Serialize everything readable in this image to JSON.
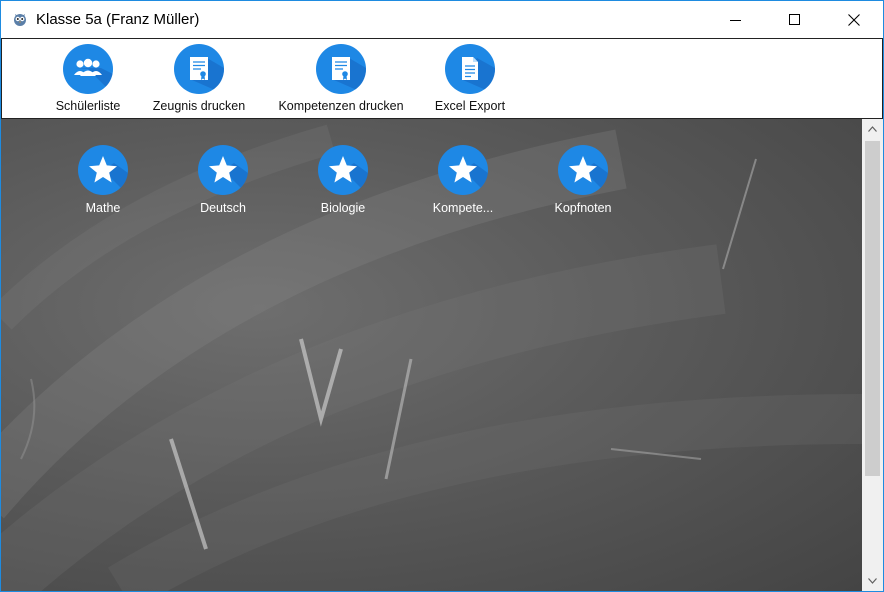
{
  "window": {
    "title": "Klasse 5a (Franz Müller)",
    "accent": "#1e8be0"
  },
  "toolbar": {
    "items": [
      {
        "label": "Schülerliste",
        "icon": "students-group-icon"
      },
      {
        "label": "Zeugnis drucken",
        "icon": "certificate-icon"
      },
      {
        "label": "Kompetenzen drucken",
        "icon": "certificate-icon"
      },
      {
        "label": "Excel Export",
        "icon": "document-icon"
      }
    ]
  },
  "subjects": [
    {
      "label": "Mathe",
      "icon": "star-icon"
    },
    {
      "label": "Deutsch",
      "icon": "star-icon"
    },
    {
      "label": "Biologie",
      "icon": "star-icon"
    },
    {
      "label": "Kompete...",
      "icon": "star-icon"
    },
    {
      "label": "Kopfnoten",
      "icon": "star-icon"
    }
  ],
  "colors": {
    "icon_blue": "#1e88e5",
    "icon_shadow": "#1565c0",
    "board": "#5a5a5a"
  }
}
